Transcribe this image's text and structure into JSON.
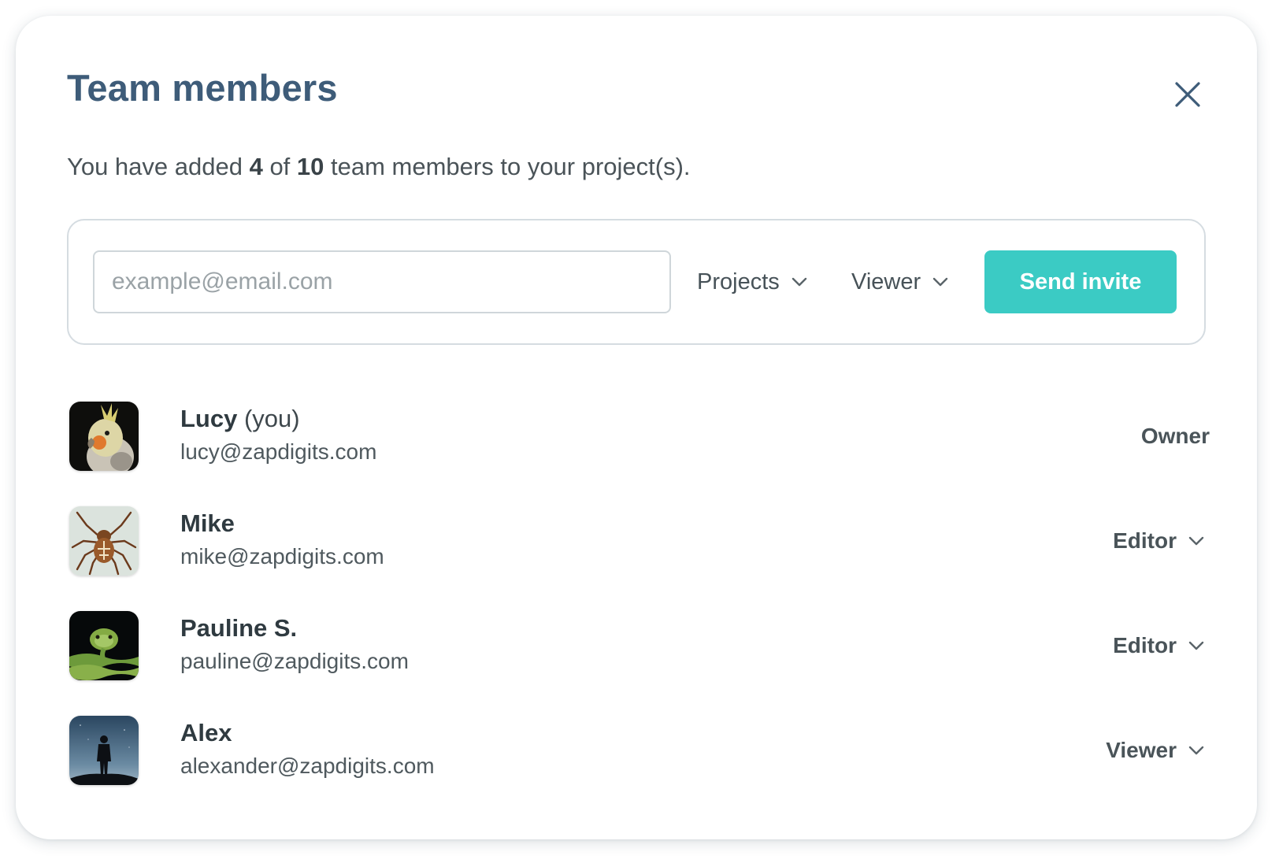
{
  "dialog": {
    "title": "Team members",
    "subtitle": {
      "prefix": "You have added ",
      "added": "4",
      "middle": " of ",
      "limit": "10",
      "suffix": " team members to your project(s)."
    }
  },
  "invite": {
    "email_placeholder": "example@email.com",
    "email_value": "",
    "projects_label": "Projects",
    "role_label": "Viewer",
    "send_label": "Send invite"
  },
  "members": [
    {
      "name": "Lucy",
      "you_label": "(you)",
      "email": "lucy@zapdigits.com",
      "role": "Owner",
      "avatar": "cockatiel"
    },
    {
      "name": "Mike",
      "you_label": "",
      "email": "mike@zapdigits.com",
      "role": "Editor",
      "avatar": "spider"
    },
    {
      "name": "Pauline S.",
      "you_label": "",
      "email": "pauline@zapdigits.com",
      "role": "Editor",
      "avatar": "snake"
    },
    {
      "name": "Alex",
      "you_label": "",
      "email": "alexander@zapdigits.com",
      "role": "Viewer",
      "avatar": "silhouette"
    }
  ],
  "colors": {
    "title": "#3e5c79",
    "accent": "#3bcbc4",
    "text": "#4a5358"
  },
  "icons": {
    "close": "close-icon",
    "dropdown": "chevron-down-icon"
  }
}
